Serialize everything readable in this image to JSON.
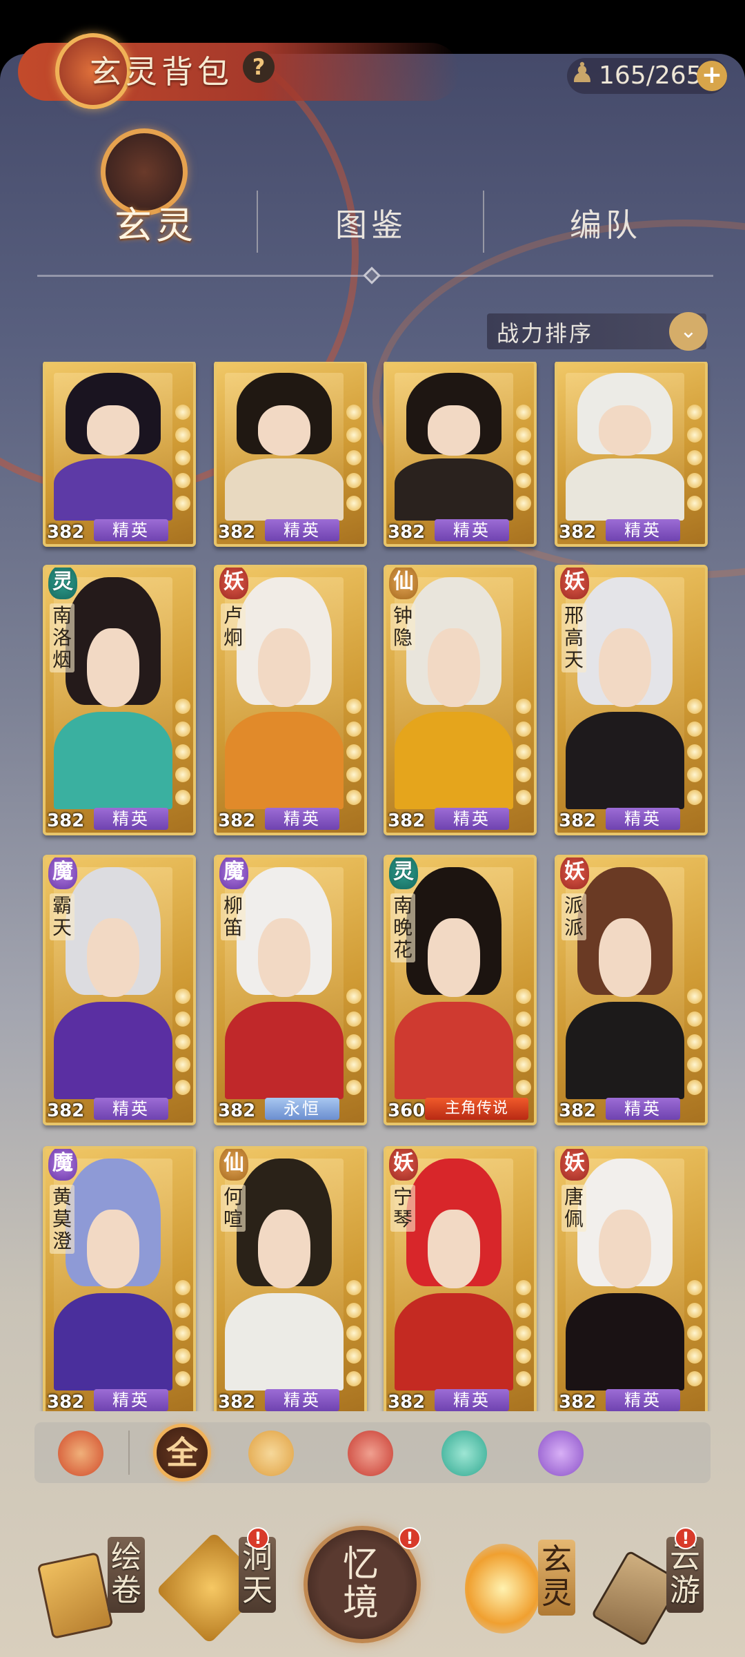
{
  "header": {
    "title": "玄灵背包",
    "help_symbol": "?",
    "capacity": "165/265",
    "add_symbol": "+"
  },
  "tabs": [
    {
      "label": "玄灵",
      "active": true
    },
    {
      "label": "图鉴",
      "active": false
    },
    {
      "label": "编队",
      "active": false
    }
  ],
  "sort": {
    "label": "战力排序"
  },
  "cards": [
    {
      "name": "",
      "faction": "",
      "level": "382",
      "rank": "精英",
      "hair": "#1a1420",
      "robe": "#5d3aa6"
    },
    {
      "name": "",
      "faction": "",
      "level": "382",
      "rank": "精英",
      "hair": "#201812",
      "robe": "#e8d9c0"
    },
    {
      "name": "",
      "faction": "",
      "level": "382",
      "rank": "精英",
      "hair": "#1e1612",
      "robe": "#2a221e"
    },
    {
      "name": "",
      "faction": "",
      "level": "382",
      "rank": "精英",
      "hair": "#ecebe6",
      "robe": "#e9e6dc"
    },
    {
      "name": "南洛烟",
      "faction": "灵",
      "level": "382",
      "rank": "精英",
      "hair": "#241a1a",
      "robe": "#3ab0a0"
    },
    {
      "name": "卢炯",
      "faction": "妖",
      "level": "382",
      "rank": "精英",
      "hair": "#f1ece6",
      "robe": "#e18a2a"
    },
    {
      "name": "钟隐",
      "faction": "仙",
      "level": "382",
      "rank": "精英",
      "hair": "#e9e5dc",
      "robe": "#e5a51c"
    },
    {
      "name": "邢高天",
      "faction": "妖",
      "level": "382",
      "rank": "精英",
      "hair": "#e4e4e8",
      "robe": "#1e1a1c"
    },
    {
      "name": "霸天",
      "faction": "魔",
      "level": "382",
      "rank": "精英",
      "hair": "#dcdce0",
      "robe": "#5a2fa2"
    },
    {
      "name": "柳笛",
      "faction": "魔",
      "level": "382",
      "rank": "永恒",
      "hair": "#f0eeec",
      "robe": "#c0282a"
    },
    {
      "name": "南晚花",
      "faction": "灵",
      "level": "360",
      "rank": "主角传说",
      "hair": "#1c1410",
      "robe": "#cf3a30"
    },
    {
      "name": "派派",
      "faction": "妖",
      "level": "382",
      "rank": "精英",
      "hair": "#6a3a24",
      "robe": "#1c1a1a"
    },
    {
      "name": "黄莫澄",
      "faction": "魔",
      "level": "382",
      "rank": "精英",
      "hair": "#8e9ad6",
      "robe": "#4a2f9c"
    },
    {
      "name": "何喧",
      "faction": "仙",
      "level": "382",
      "rank": "精英",
      "hair": "#2a2218",
      "robe": "#ecebe6"
    },
    {
      "name": "宁琴",
      "faction": "妖",
      "level": "382",
      "rank": "精英",
      "hair": "#d8262a",
      "robe": "#c42a22"
    },
    {
      "name": "唐佩",
      "faction": "妖",
      "level": "382",
      "rank": "精英",
      "hair": "#f2efec",
      "robe": "#1a1214"
    }
  ],
  "filters": [
    {
      "icon": "all-factions-filter-icon",
      "color": "#d14a2a"
    },
    {
      "label": "全",
      "active": true
    },
    {
      "icon": "xian-lotus-filter-icon",
      "color": "#e0a040"
    },
    {
      "icon": "yao-spider-filter-icon",
      "color": "#c83a30"
    },
    {
      "icon": "ling-flame-filter-icon",
      "color": "#2fa890"
    },
    {
      "icon": "mo-crystal-filter-icon",
      "color": "#8a50c8"
    }
  ],
  "nav": {
    "huijuan": "绘卷",
    "dongtian": "洞天",
    "yijing": "忆境",
    "xuanling": "玄灵",
    "yunyou": "云游",
    "alert": "!"
  }
}
